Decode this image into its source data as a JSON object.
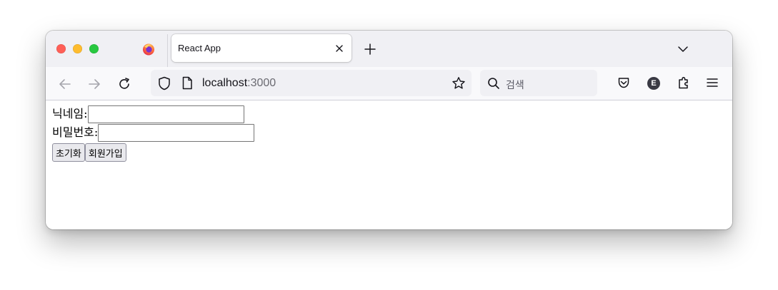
{
  "browser": {
    "tab": {
      "title": "React App"
    },
    "url": {
      "host": "localhost",
      "port": ":3000"
    },
    "search": {
      "placeholder": "검색"
    },
    "extension_avatar_letter": "E",
    "icons": [
      "firefox-logo-icon",
      "close-icon",
      "plus-icon",
      "chevron-down-icon",
      "back-arrow-icon",
      "forward-arrow-icon",
      "reload-icon",
      "shield-icon",
      "page-icon",
      "star-icon",
      "search-icon",
      "pocket-icon",
      "puzzle-icon",
      "hamburger-menu-icon"
    ]
  },
  "form": {
    "nickname_label": "닉네임:",
    "nickname_value": "",
    "password_label": "비밀번호:",
    "password_value": "",
    "reset_button": "초기화",
    "signup_button": "회원가입"
  },
  "colors": {
    "traffic_red": "#ff5f57",
    "traffic_yellow": "#febc2e",
    "traffic_green": "#28c840",
    "titlebar": "#f0f0f4",
    "navbar": "#f9f9fb"
  }
}
